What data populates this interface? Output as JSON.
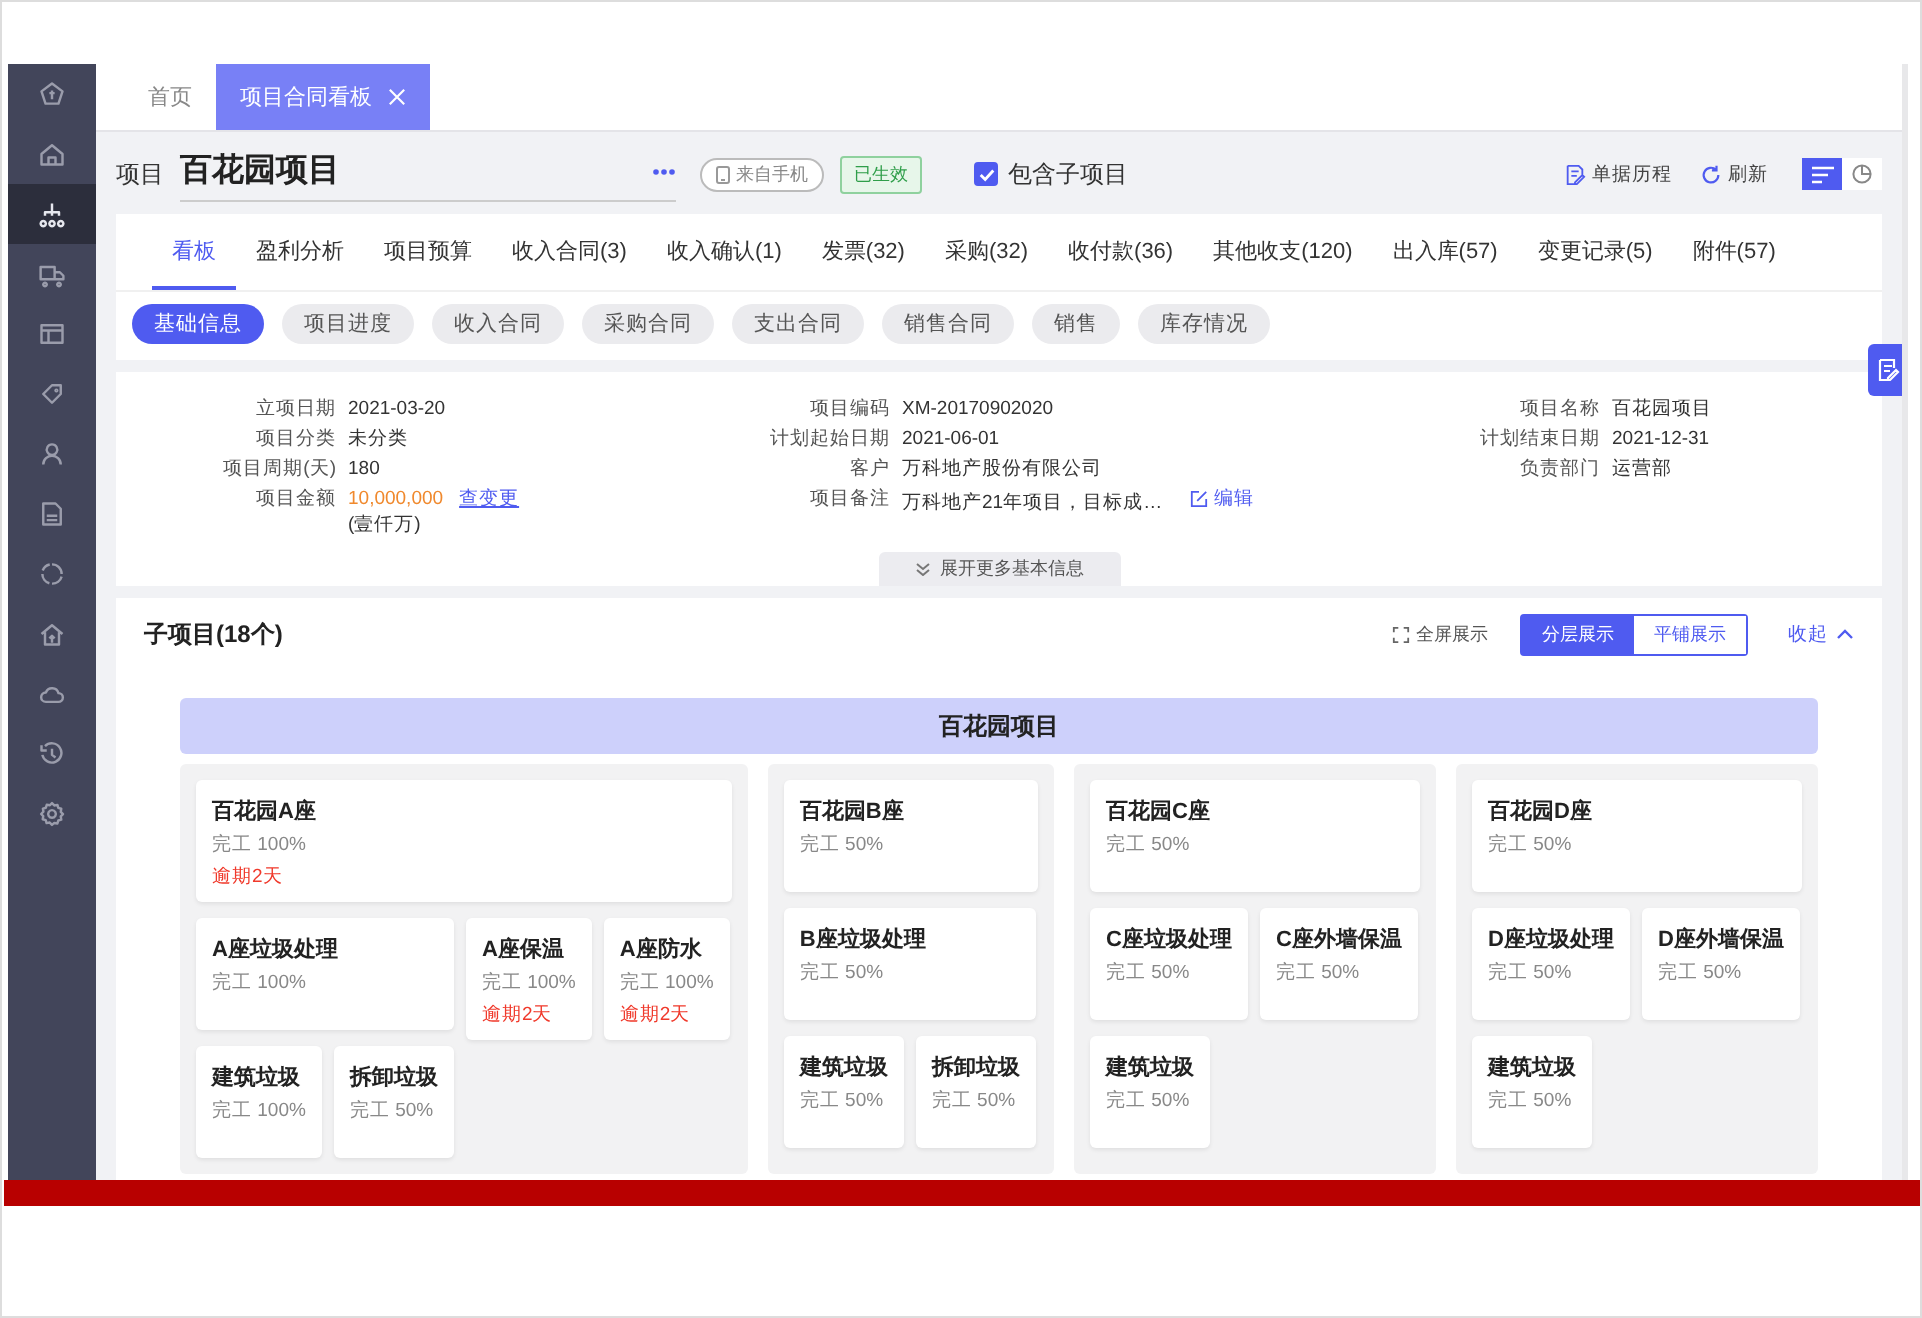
{
  "sidebar": {
    "items": [
      {
        "selected": false
      },
      {
        "selected": false
      },
      {
        "selected": true
      },
      {
        "selected": false
      },
      {
        "selected": false
      },
      {
        "selected": false
      },
      {
        "selected": false
      },
      {
        "selected": false
      },
      {
        "selected": false
      },
      {
        "selected": false
      },
      {
        "selected": false
      },
      {
        "selected": false
      },
      {
        "selected": false
      }
    ]
  },
  "page_tabs": [
    {
      "label": "首页",
      "selected": false,
      "closable": false
    },
    {
      "label": "项目合同看板",
      "selected": true,
      "closable": true
    }
  ],
  "header": {
    "label": "项目",
    "title": "百花园项目",
    "source_badge": "来自手机",
    "status_badge": "已生效",
    "include_children": {
      "label": "包含子项目",
      "checked": true
    },
    "actions": [
      {
        "label": "单据历程"
      },
      {
        "label": "刷新"
      }
    ],
    "view_toggle": [
      {
        "selected": true
      },
      {
        "selected": false
      }
    ]
  },
  "tabs": [
    {
      "label": "看板",
      "selected": true
    },
    {
      "label": "盈利分析",
      "selected": false
    },
    {
      "label": "项目预算",
      "selected": false
    },
    {
      "label": "收入合同(3)",
      "selected": false
    },
    {
      "label": "收入确认(1)",
      "selected": false
    },
    {
      "label": "发票(32)",
      "selected": false
    },
    {
      "label": "采购(32)",
      "selected": false
    },
    {
      "label": "收付款(36)",
      "selected": false
    },
    {
      "label": "其他收支(120)",
      "selected": false
    },
    {
      "label": "出入库(57)",
      "selected": false
    },
    {
      "label": "变更记录(5)",
      "selected": false
    },
    {
      "label": "附件(57)",
      "selected": false
    }
  ],
  "filters": [
    {
      "label": "基础信息",
      "selected": true
    },
    {
      "label": "项目进度",
      "selected": false
    },
    {
      "label": "收入合同",
      "selected": false
    },
    {
      "label": "采购合同",
      "selected": false
    },
    {
      "label": "支出合同",
      "selected": false
    },
    {
      "label": "销售合同",
      "selected": false
    },
    {
      "label": "销售",
      "selected": false
    },
    {
      "label": "库存情况",
      "selected": false
    }
  ],
  "info": {
    "columns": [
      [
        {
          "label": "立项日期",
          "value": "2021-03-20",
          "highlight": false
        },
        {
          "label": "项目分类",
          "value": "未分类",
          "highlight": false
        },
        {
          "label": "项目周期(天)",
          "value": "180",
          "highlight": false
        },
        {
          "label": "项目金额",
          "value": "10,000,000",
          "highlight": true,
          "action": {
            "kind": "link",
            "label": "查变更"
          },
          "note": "(壹仟万)"
        }
      ],
      [
        {
          "label": "项目编码",
          "value": "XM-20170902020",
          "highlight": false
        },
        {
          "label": "计划起始日期",
          "value": "2021-06-01",
          "highlight": false
        },
        {
          "label": "客户",
          "value": "万科地产股份有限公司",
          "highlight": false
        },
        {
          "label": "项目备注",
          "value": "万科地产21年项目，目标成…",
          "highlight": false,
          "action": {
            "kind": "edit",
            "label": "编辑"
          }
        }
      ],
      [
        {
          "label": "项目名称",
          "value": "百花园项目",
          "highlight": false
        },
        {
          "label": "计划结束日期",
          "value": "2021-12-31",
          "highlight": false
        },
        {
          "label": "负责部门",
          "value": "运营部",
          "highlight": false
        }
      ]
    ],
    "expand": "展开更多基本信息"
  },
  "subprojects": {
    "title": "子项目(18个)",
    "fullscreen": "全屏展示",
    "view_modes": [
      {
        "label": "分层展示",
        "selected": true
      },
      {
        "label": "平铺展示",
        "selected": false
      }
    ],
    "collapse": "收起",
    "root": "百花园项目",
    "groups": [
      {
        "name": "百花园A座",
        "progress": "完工 100%",
        "overdue": "逾期2天",
        "children": [
          {
            "name": "A座垃圾处理",
            "progress": "完工 100%",
            "children": [
              {
                "name": "建筑垃圾",
                "progress": "完工 100%"
              },
              {
                "name": "拆卸垃圾",
                "progress": "完工 50%"
              }
            ]
          },
          {
            "name": "A座保温",
            "progress": "完工 100%",
            "overdue": "逾期2天"
          },
          {
            "name": "A座防水",
            "progress": "完工 100%",
            "overdue": "逾期2天"
          }
        ]
      },
      {
        "name": "百花园B座",
        "progress": "完工 50%",
        "children": [
          {
            "name": "B座垃圾处理",
            "progress": "完工 50%",
            "children": [
              {
                "name": "建筑垃圾",
                "progress": "完工 50%"
              },
              {
                "name": "拆卸垃圾",
                "progress": "完工 50%"
              }
            ]
          }
        ]
      },
      {
        "name": "百花园C座",
        "progress": "完工 50%",
        "children": [
          {
            "name": "C座垃圾处理",
            "progress": "完工 50%",
            "children": [
              {
                "name": "建筑垃圾",
                "progress": "完工 50%"
              }
            ]
          },
          {
            "name": "C座外墙保温",
            "progress": "完工 50%"
          }
        ]
      },
      {
        "name": "百花园D座",
        "progress": "完工 50%",
        "children": [
          {
            "name": "D座垃圾处理",
            "progress": "完工 50%",
            "children": [
              {
                "name": "建筑垃圾",
                "progress": "完工 50%"
              }
            ]
          },
          {
            "name": "D座外墙保温",
            "progress": "完工 50%"
          }
        ]
      }
    ]
  }
}
